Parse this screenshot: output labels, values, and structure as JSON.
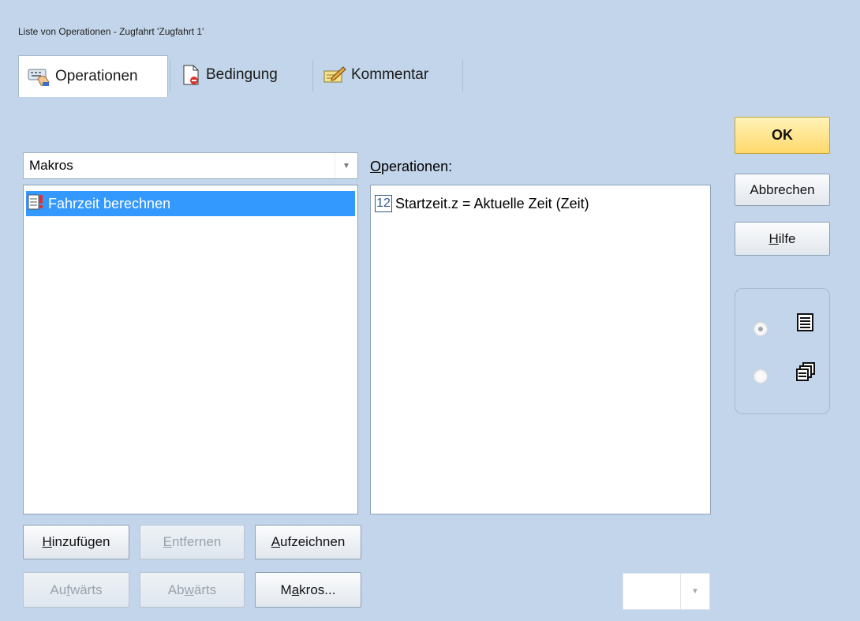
{
  "window": {
    "title": "Liste von Operationen - Zugfahrt 'Zugfahrt 1'"
  },
  "tabs": [
    {
      "label": "Operationen",
      "icon": "keyboard-hand-icon",
      "active": true
    },
    {
      "label": "Bedingung",
      "icon": "document-condition-icon",
      "active": false
    },
    {
      "label": "Kommentar",
      "icon": "pencil-note-icon",
      "active": false
    }
  ],
  "macro_selector": {
    "value": "Makros",
    "options_visible": [
      "Makros"
    ]
  },
  "macro_list": {
    "items": [
      {
        "label": "Fahrzeit berechnen",
        "icon": "macro-script-icon",
        "selected": true
      }
    ]
  },
  "operations": {
    "label_prefix": "O",
    "label_rest": "perationen:",
    "items": [
      {
        "label": "Startzeit.z = Aktuelle Zeit (Zeit)",
        "icon_text": "12",
        "icon": "numeric-value-icon"
      }
    ]
  },
  "buttons": {
    "ok": "OK",
    "cancel": "Abbrechen",
    "help_prefix": "H",
    "help_rest": "ilfe",
    "add_prefix": "H",
    "add_rest": "inzufügen",
    "remove_prefix": "E",
    "remove_rest": "ntfernen",
    "record_prefix": "A",
    "record_rest": "ufzeichnen",
    "up_pre": "Au",
    "up_key": "f",
    "up_rest": "wärts",
    "down_pre": "Ab",
    "down_key": "w",
    "down_rest": "ärts",
    "macros_pre": "M",
    "macros_key": "a",
    "macros_rest": "kros..."
  },
  "view_mode": {
    "options": [
      {
        "icon": "list-view-icon",
        "selected": true
      },
      {
        "icon": "cascade-view-icon",
        "selected": false
      }
    ]
  },
  "colors": {
    "background": "#c2d5ea",
    "selection": "#3399ff",
    "ok_button": "#ffd86b"
  }
}
